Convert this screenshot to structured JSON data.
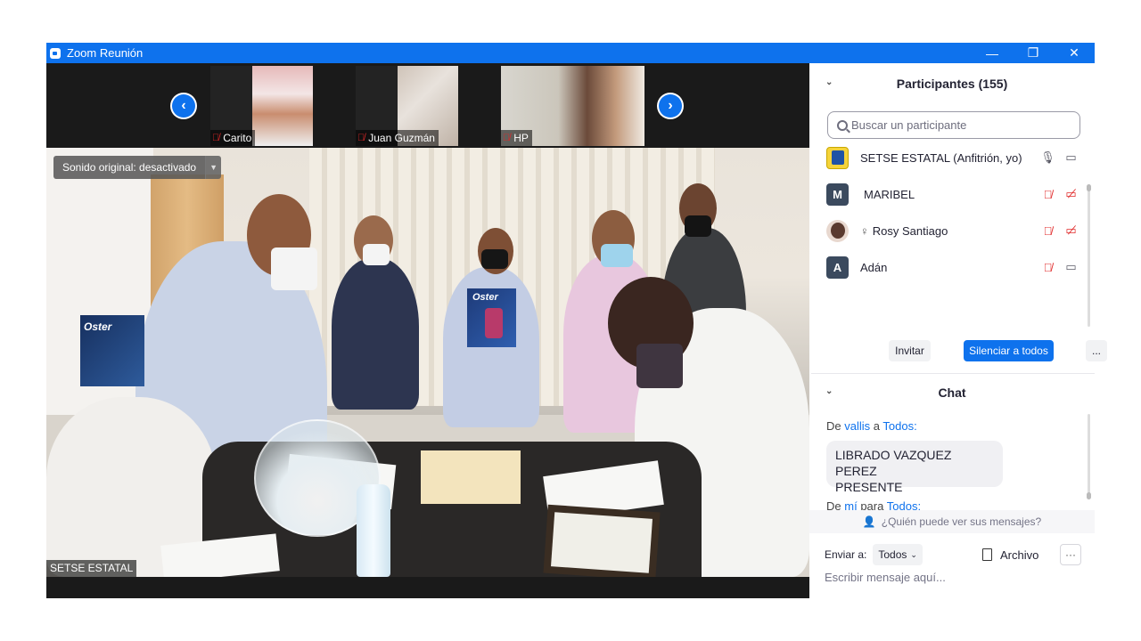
{
  "window": {
    "title": "Zoom Reunión",
    "controls": [
      "—",
      "❐",
      "✕"
    ]
  },
  "thumbnails": [
    {
      "name": "Carito",
      "muted": true
    },
    {
      "name": "Juan Guzmán",
      "muted": true
    },
    {
      "name": "HP",
      "muted": true
    }
  ],
  "main_video": {
    "sound_label": "Sonido original: desactivado",
    "speaker_name": "SETSE ESTATAL",
    "products": {
      "box_brand": "Oster"
    }
  },
  "participants": {
    "header": "Participantes (155)",
    "search_placeholder": "Buscar un participante",
    "list": [
      {
        "name": "SETSE ESTATAL (Anfitrión, yo)",
        "avatar": "",
        "avatar_color": "#f5d33a",
        "audio": "on",
        "video": "on"
      },
      {
        "name": "MARIBEL",
        "avatar": "M",
        "avatar_color": "#3b4a5e",
        "audio": "muted",
        "video": "off"
      },
      {
        "name": "Rosy Santiago",
        "avatar": "",
        "avatar_color": "#6f4c3e",
        "audio": "muted",
        "video": "off",
        "prefix_icon": "hand-lowered-icon"
      },
      {
        "name": "Adán",
        "avatar": "A",
        "avatar_color": "#3b4a5e",
        "audio": "muted",
        "video": "on"
      }
    ],
    "invite_label": "Invitar",
    "mute_all_label": "Silenciar a todos",
    "more_label": "..."
  },
  "chat": {
    "header": "Chat",
    "messages": [
      {
        "from_prefix": "De",
        "from": "vallis",
        "to_prefix": "a",
        "to": "Todos:",
        "text_line1": "LIBRADO VAZQUEZ PEREZ",
        "text_line2": "PRESENTE"
      },
      {
        "from_prefix": "De",
        "from": "mí",
        "to_prefix": "para",
        "to": "Todos:"
      }
    ],
    "who_can_see": "¿Quién puede ver sus mensajes?",
    "send_to_label": "Enviar a:",
    "send_to_value": "Todos",
    "file_label": "Archivo",
    "more_label": "···",
    "input_placeholder": "Escribir mensaje aquí..."
  },
  "colors": {
    "accent": "#0e72ed",
    "muted_red": "#e02828",
    "titlebar": "#0e72ed"
  }
}
